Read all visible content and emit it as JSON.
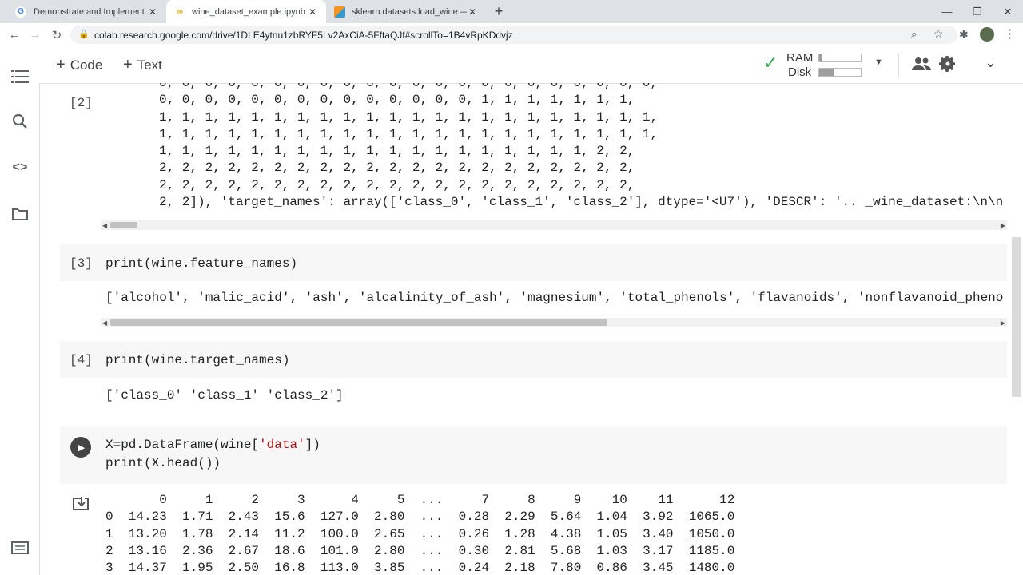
{
  "browser": {
    "tabs": [
      {
        "title": "Demonstrate and Implement the",
        "icon": "google-icon",
        "active": false
      },
      {
        "title": "wine_dataset_example.ipynb - Co",
        "icon": "colab-icon",
        "active": true
      },
      {
        "title": "sklearn.datasets.load_wine — sci",
        "icon": "sklearn-icon",
        "active": false
      }
    ],
    "url": "colab.research.google.com/drive/1DLE4ytnu1zbRYF5Lv2AxCiA-5FftaQJf#scrollTo=1B4vRpKDdvjz"
  },
  "toolbar": {
    "code_label": "Code",
    "text_label": "Text",
    "ram_label": "RAM",
    "disk_label": "Disk",
    "ram_usage": 0.05,
    "disk_usage": 0.35
  },
  "cells": {
    "c2": {
      "exec": "[2]",
      "lines": [
        "0, 0, 0, 0, 0, 0, 0, 0, 0, 0, 0, 0, 0, 0, 0, 0, 0, 0, 0, 0, 0, 0,",
        "0, 0, 0, 0, 0, 0, 0, 0, 0, 0, 0, 0, 0, 0, 1, 1, 1, 1, 1, 1, 1,",
        "1, 1, 1, 1, 1, 1, 1, 1, 1, 1, 1, 1, 1, 1, 1, 1, 1, 1, 1, 1, 1, 1,",
        "1, 1, 1, 1, 1, 1, 1, 1, 1, 1, 1, 1, 1, 1, 1, 1, 1, 1, 1, 1, 1, 1,",
        "1, 1, 1, 1, 1, 1, 1, 1, 1, 1, 1, 1, 1, 1, 1, 1, 1, 1, 1, 2, 2,",
        "2, 2, 2, 2, 2, 2, 2, 2, 2, 2, 2, 2, 2, 2, 2, 2, 2, 2, 2, 2, 2,",
        "2, 2, 2, 2, 2, 2, 2, 2, 2, 2, 2, 2, 2, 2, 2, 2, 2, 2, 2, 2, 2,",
        "2, 2]), 'target_names': array(['class_0', 'class_1', 'class_2'], dtype='<U7'), 'DESCR': '.. _wine_dataset:\\n\\n"
      ]
    },
    "c3": {
      "exec": "[3]",
      "code": "print(wine.feature_names)",
      "output": "['alcohol', 'malic_acid', 'ash', 'alcalinity_of_ash', 'magnesium', 'total_phenols', 'flavanoids', 'nonflavanoid_pheno"
    },
    "c4": {
      "exec": "[4]",
      "code": "print(wine.target_names)",
      "output": "['class_0' 'class_1' 'class_2']"
    },
    "c5": {
      "code_prefix1": "X=pd.DataFrame(wine[",
      "code_str": "'data'",
      "code_suffix1": "])",
      "code_line2": "print(X.head())",
      "table_lines": [
        "       0     1     2     3      4     5  ...     7     8     9    10    11      12",
        "0  14.23  1.71  2.43  15.6  127.0  2.80  ...  0.28  2.29  5.64  1.04  3.92  1065.0",
        "1  13.20  1.78  2.14  11.2  100.0  2.65  ...  0.26  1.28  4.38  1.05  3.40  1050.0",
        "2  13.16  2.36  2.67  18.6  101.0  2.80  ...  0.30  2.81  5.68  1.03  3.17  1185.0",
        "3  14.37  1.95  2.50  16.8  113.0  3.85  ...  0.24  2.18  7.80  0.86  3.45  1480.0"
      ]
    }
  }
}
